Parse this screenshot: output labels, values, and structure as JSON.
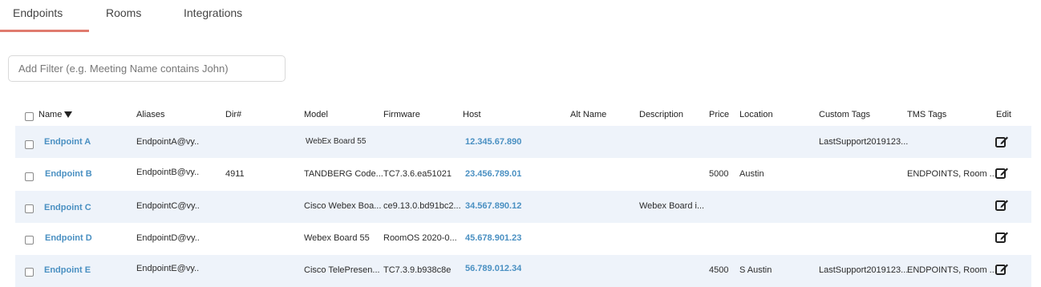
{
  "tabs": [
    {
      "label": "Endpoints"
    },
    {
      "label": "Rooms"
    },
    {
      "label": "Integrations"
    }
  ],
  "filter": {
    "placeholder": "Add Filter (e.g. Meeting Name contains John)",
    "value": ""
  },
  "table": {
    "headers": {
      "name": "Name",
      "aliases": "Aliases",
      "dir": "Dir#",
      "model": "Model",
      "firmware": "Firmware",
      "host": "Host",
      "alt_name": "Alt Name",
      "description": "Description",
      "price": "Price",
      "location": "Location",
      "custom_tags": "Custom Tags",
      "tms_tags": "TMS Tags",
      "edit": "Edit"
    },
    "rows": [
      {
        "name": "Endpoint A",
        "aliases": "EndpointA@vy..",
        "dir": "",
        "model": "WebEx Board 55",
        "firmware": "",
        "host": "12.345.67.890",
        "alt_name": "",
        "description": "",
        "price": "",
        "location": "",
        "custom_tags": "LastSupport2019123...",
        "tms_tags": ""
      },
      {
        "name": "Endpoint B",
        "aliases": "EndpointB@vy..",
        "dir": "4911",
        "model": "TANDBERG Code...",
        "firmware": "TC7.3.6.ea51021",
        "host": "23.456.789.01",
        "alt_name": "",
        "description": "",
        "price": "5000",
        "location": "Austin",
        "custom_tags": "",
        "tms_tags": "ENDPOINTS, Room ..."
      },
      {
        "name": "Endpoint C",
        "aliases": "EndpointC@vy..",
        "dir": "",
        "model": "Cisco Webex Boa...",
        "firmware": "ce9.13.0.bd91bc2...",
        "host": "34.567.890.12",
        "alt_name": "",
        "description": "Webex Board i...",
        "price": "",
        "location": "",
        "custom_tags": "",
        "tms_tags": ""
      },
      {
        "name": "Endpoint D",
        "aliases": "EndpointD@vy..",
        "dir": "",
        "model": "Webex Board 55",
        "firmware": "RoomOS 2020-0...",
        "host": "45.678.901.23",
        "alt_name": "",
        "description": "",
        "price": "",
        "location": "",
        "custom_tags": "",
        "tms_tags": ""
      },
      {
        "name": "Endpoint E",
        "aliases": "EndpointE@vy..",
        "dir": "",
        "model": "Cisco TelePresen...",
        "firmware": "TC7.3.9.b938c8e",
        "host": "56.789.012.34",
        "alt_name": "",
        "description": "",
        "price": "4500",
        "location": "S Austin",
        "custom_tags": "LastSupport2019123...",
        "tms_tags": "ENDPOINTS, Room ..."
      }
    ]
  },
  "colors": {
    "accent_underline": "#e07b6e",
    "link": "#4a90c2",
    "row_shade": "#eef3fa"
  }
}
